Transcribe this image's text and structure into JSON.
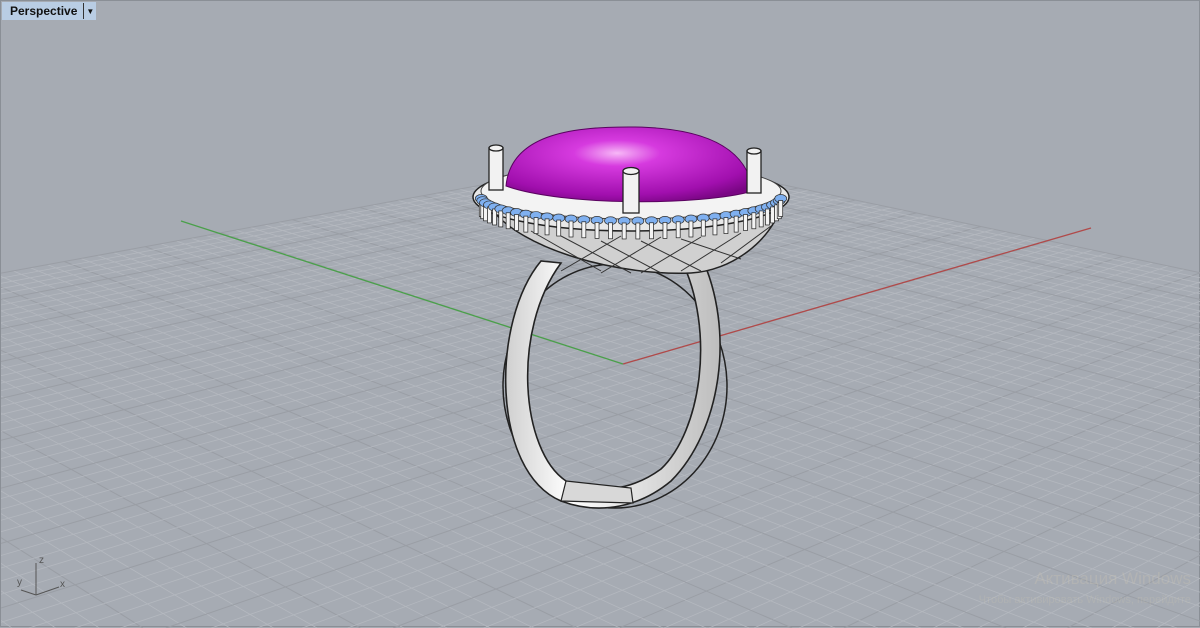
{
  "viewport": {
    "title": "Perspective",
    "dropdown_icon": "triangle-down",
    "axis_labels": {
      "x": "x",
      "y": "y",
      "z": "z"
    }
  },
  "colors": {
    "background": "#a6abb3",
    "grid_minor": "#b4b8bf",
    "grid_major": "#9a9ea5",
    "x_axis": "#b04a4a",
    "y_axis": "#4aa04a",
    "gem": "#c21ad0",
    "accent_stones": "#7fb0f0",
    "metal": "#e6e6e6"
  },
  "watermark": {
    "line1": "Активация Windows",
    "line2": "Чтобы активировать Windows, перейдите"
  }
}
